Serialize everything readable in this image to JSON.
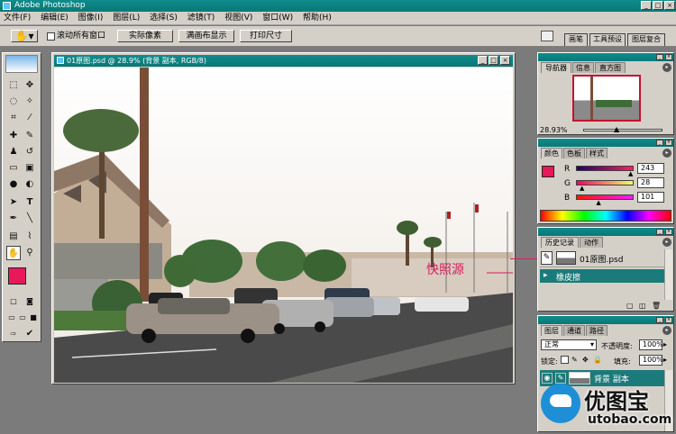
{
  "window": {
    "title": "Adobe Photoshop",
    "buttons": [
      "_",
      "□",
      "×"
    ]
  },
  "menu": [
    "文件(F)",
    "编辑(E)",
    "图像(I)",
    "图层(L)",
    "选择(S)",
    "滤镜(T)",
    "视图(V)",
    "窗口(W)",
    "帮助(H)"
  ],
  "options": {
    "tool_icon": "hand-icon",
    "scroll_all_label": "滚动所有窗口",
    "actual_pixels": "实际像素",
    "fit_screen": "满画布显示",
    "print_size": "打印尺寸",
    "well_tabs": [
      "画笔",
      "工具预设",
      "图层复合"
    ]
  },
  "document": {
    "title": "01原图.psd @ 28.9% (背景 副本, RGB/8)",
    "annotation": "快照源"
  },
  "colors": {
    "foreground": "#e8185a",
    "background": "#ffffff",
    "titlebar": "#0a7777",
    "history_selected": "#1b7b7b"
  },
  "navigator": {
    "tabs": [
      "导航器",
      "信息",
      "直方图"
    ],
    "zoom": "28.93%"
  },
  "color_panel": {
    "tabs": [
      "颜色",
      "色板",
      "样式"
    ],
    "r_label": "R",
    "g_label": "G",
    "b_label": "B",
    "r": 243,
    "g": 28,
    "b": 101,
    "r_value": "243",
    "g_value": "28",
    "b_value": "101"
  },
  "history": {
    "tabs": [
      "历史记录",
      "动作"
    ],
    "snapshot": "01原图.psd",
    "steps": [
      "橡皮擦"
    ]
  },
  "layers": {
    "tabs": [
      "图层",
      "通道",
      "路径"
    ],
    "blend_mode": "正常",
    "opacity_label": "不透明度:",
    "opacity": "100%",
    "lock_label": "锁定:",
    "fill_label": "填充:",
    "fill": "100%",
    "rows": [
      "背景 副本"
    ]
  },
  "watermark": {
    "cn": "优图宝",
    "url": "utobao.com"
  }
}
